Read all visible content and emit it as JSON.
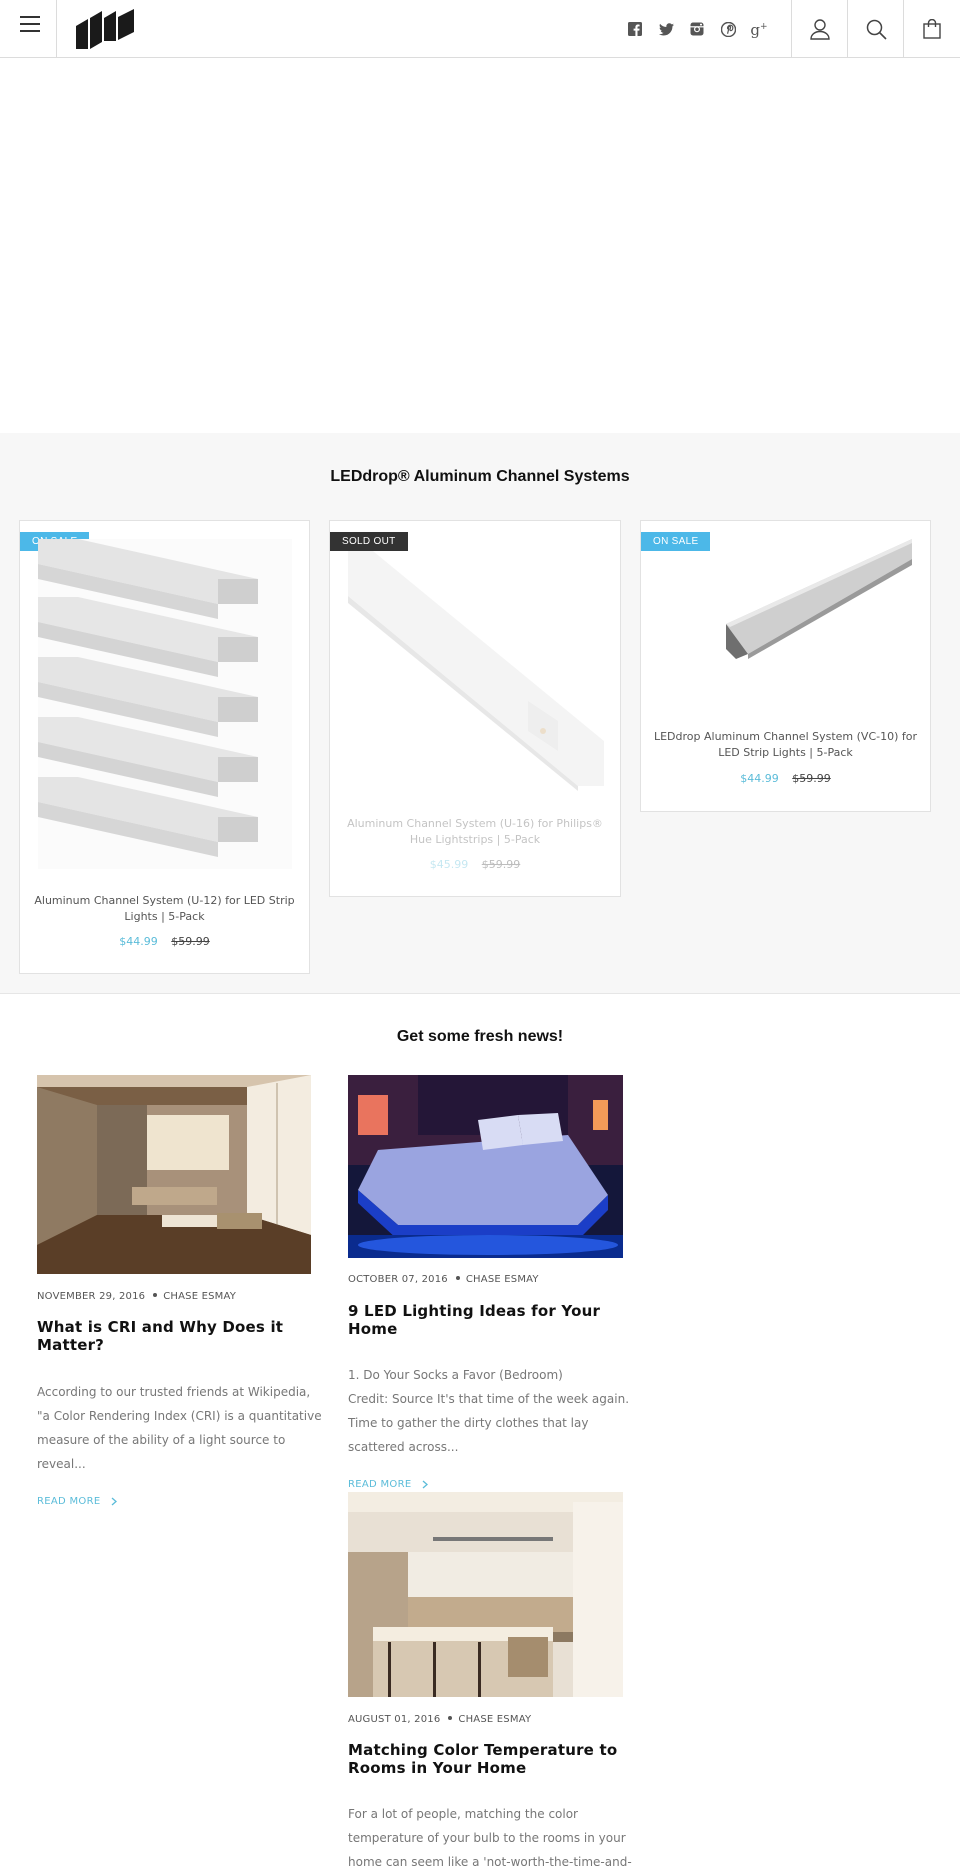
{
  "header": {
    "menu_icon": "hamburger-icon",
    "logo_icon": "ld-logo",
    "social_icons": [
      "facebook-icon",
      "twitter-icon",
      "instagram-icon",
      "pinterest-icon",
      "google-plus-icon"
    ],
    "account_icon": "user-icon",
    "search_icon": "search-icon",
    "cart_icon": "shopping-bag-icon"
  },
  "products": {
    "title": "LEDdrop® Aluminum Channel Systems",
    "items": [
      {
        "badge": "ON SALE",
        "title": "Aluminum Channel System (U-12) for LED Strip Lights | 5-Pack",
        "price": "$44.99",
        "compare_price": "$59.99"
      },
      {
        "badge": "SOLD OUT",
        "title": "Aluminum Channel System (U-16) for Philips® Hue Lightstrips | 5-Pack",
        "price": "$45.99",
        "compare_price": "$59.99"
      },
      {
        "badge": "ON SALE",
        "title": "LEDdrop Aluminum Channel System (VC-10) for LED Strip Lights | 5-Pack",
        "price": "$44.99",
        "compare_price": "$59.99"
      }
    ]
  },
  "news": {
    "title": "Get some fresh news!",
    "posts": [
      {
        "date": "NOVEMBER 29, 2016",
        "author": "CHASE ESMAY",
        "title_line1": "What is CRI and Why Does it",
        "title_line2": "Matter?",
        "excerpt": [
          "According to our trusted friends at Wikipedia,",
          "\"a Color Rendering Index (CRI) is a quantitative",
          "measure of the ability of a light source to",
          "reveal..."
        ],
        "read_more": "READ MORE"
      },
      {
        "date": "OCTOBER 07, 2016",
        "author": "CHASE ESMAY",
        "title_line1": "9 LED Lighting Ideas for Your",
        "title_line2": "Home",
        "excerpt": [
          "1. Do Your Socks a Favor (Bedroom)",
          "Credit: Source It's that time of the week again.",
          "Time to gather the dirty clothes that lay",
          "scattered across..."
        ],
        "read_more": "READ MORE"
      },
      {
        "date": "AUGUST 01, 2016",
        "author": "CHASE ESMAY",
        "title_line1": "Matching Color Temperature to",
        "title_line2": "Rooms in Your Home",
        "excerpt": [
          "For a lot of people, matching the color",
          "temperature of your bulb to the rooms in your",
          "home can seem like a 'not-worth-the-time-and-"
        ],
        "read_more": ""
      }
    ]
  },
  "colors": {
    "accent": "#5bbcd9",
    "sale_badge": "#4cb8e8",
    "sold_badge": "#333333",
    "section_bg": "#f7f7f7"
  }
}
